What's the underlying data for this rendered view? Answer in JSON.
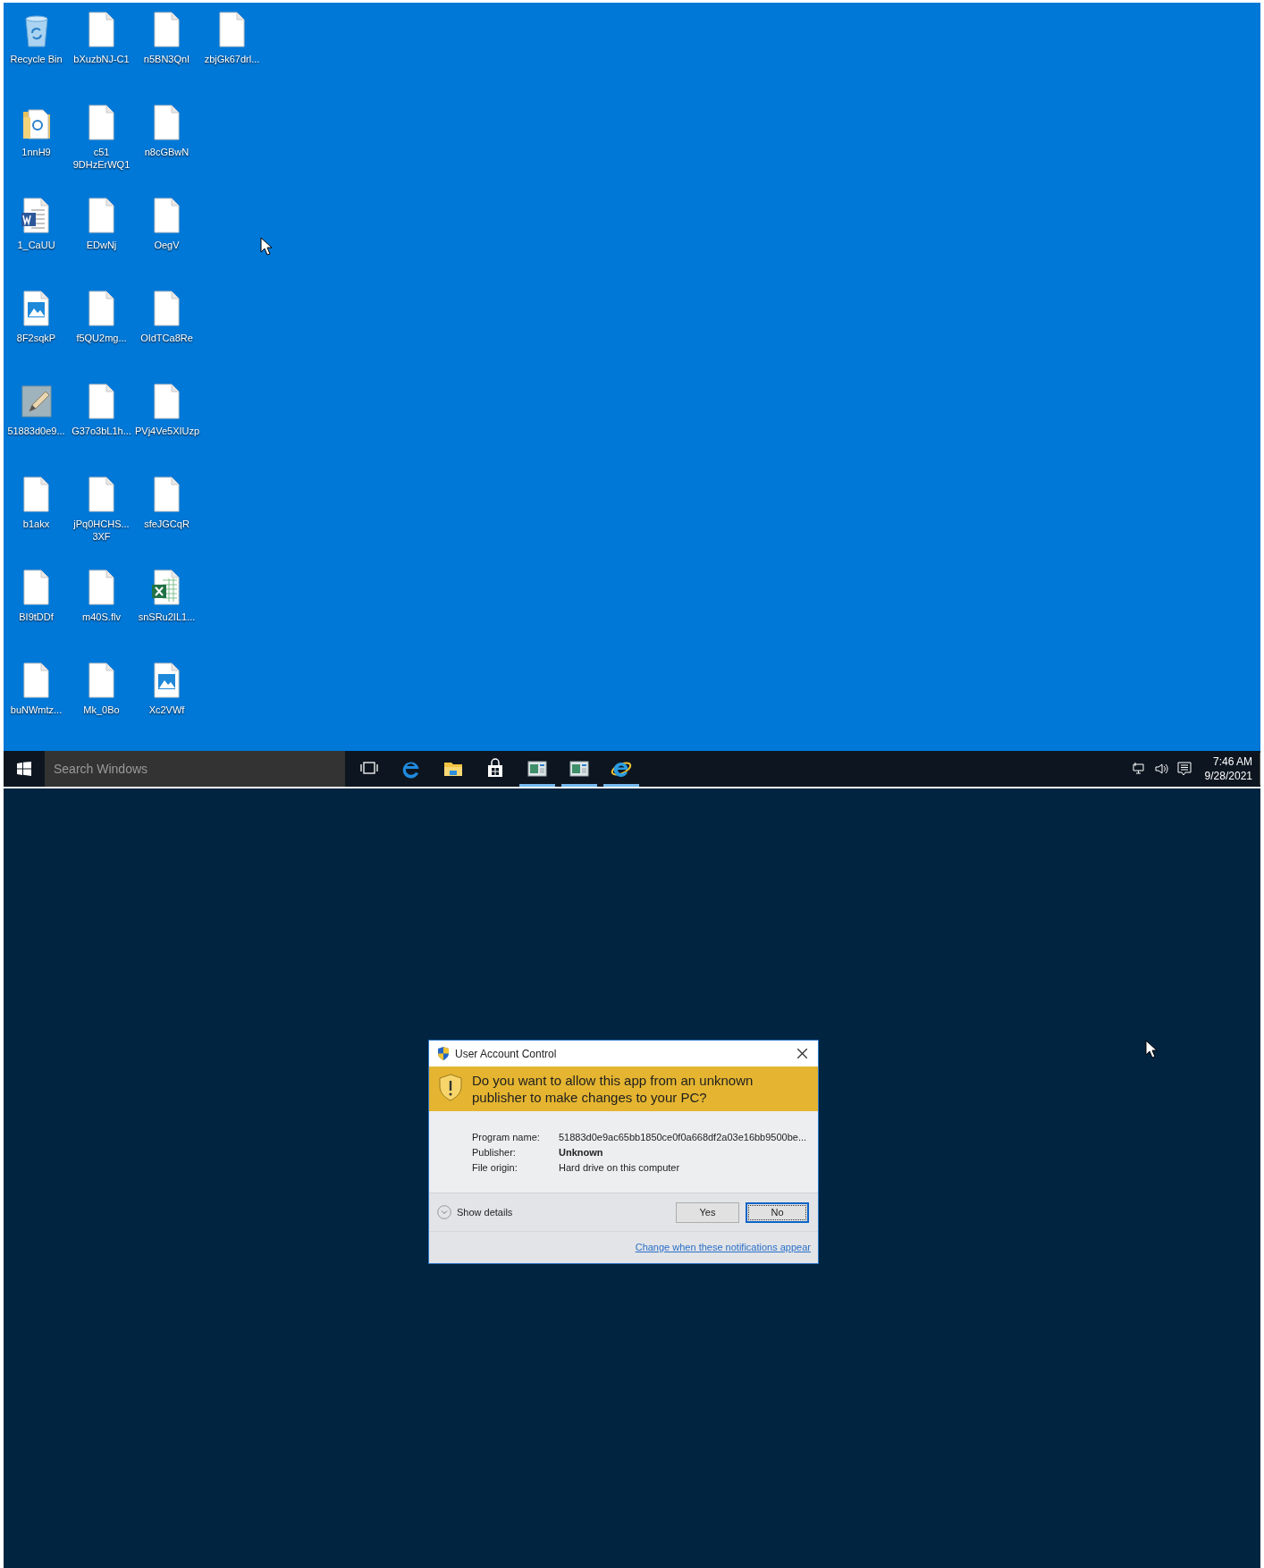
{
  "top_screen": {
    "desktop": {
      "icon_rows": [
        [
          {
            "label": "Recycle Bin",
            "kind": "recycle-bin"
          },
          {
            "label": "bXuzbNJ-C1",
            "kind": "file"
          },
          {
            "label": "n5BN3QnI",
            "kind": "file"
          },
          {
            "label": "zbjGk67drl...",
            "kind": "file"
          }
        ],
        [
          {
            "label": "1nnH9",
            "kind": "folder"
          },
          {
            "label": "c51 9DHzErWQ1",
            "kind": "file"
          },
          {
            "label": "n8cGBwN",
            "kind": "file"
          }
        ],
        [
          {
            "label": "1_CaUU",
            "kind": "word"
          },
          {
            "label": "EDwNj",
            "kind": "file"
          },
          {
            "label": "OegV",
            "kind": "file"
          }
        ],
        [
          {
            "label": "8F2sqkP",
            "kind": "image"
          },
          {
            "label": "f5QU2mg...",
            "kind": "file"
          },
          {
            "label": "OIdTCa8Re",
            "kind": "file"
          }
        ],
        [
          {
            "label": "51883d0e9...",
            "kind": "edit"
          },
          {
            "label": "G37o3bL1h...",
            "kind": "file"
          },
          {
            "label": "PVj4Ve5XIUzp",
            "kind": "file"
          }
        ],
        [
          {
            "label": "b1akx",
            "kind": "file"
          },
          {
            "label": "jPq0HCHS... 3XF",
            "kind": "file"
          },
          {
            "label": "sfeJGCqR",
            "kind": "file"
          }
        ],
        [
          {
            "label": "BI9tDDf",
            "kind": "file"
          },
          {
            "label": "m40S.flv",
            "kind": "file"
          },
          {
            "label": "snSRu2IL1...",
            "kind": "excel"
          }
        ],
        [
          {
            "label": "buNWmtz...",
            "kind": "file"
          },
          {
            "label": "Mk_0Bo",
            "kind": "file"
          },
          {
            "label": "Xc2VWf",
            "kind": "image"
          }
        ]
      ]
    },
    "taskbar": {
      "search": {
        "placeholder": "Search Windows"
      },
      "apps": [
        {
          "kind": "task-view",
          "running": false
        },
        {
          "kind": "edge",
          "running": false
        },
        {
          "kind": "explorer",
          "running": false
        },
        {
          "kind": "store",
          "running": false
        },
        {
          "kind": "window",
          "running": true
        },
        {
          "kind": "window",
          "running": true
        },
        {
          "kind": "ie",
          "running": true
        }
      ],
      "clock": {
        "time": "7:46 AM",
        "date": "9/28/2021"
      }
    }
  },
  "bottom_screen": {
    "dialog": {
      "title": "User Account Control",
      "question": "Do you want to allow this app from an unknown publisher to make changes to your PC?",
      "details": [
        {
          "label": "Program name:",
          "value": "51883d0e9ac65bb1850ce0f0a668df2a03e16bb9500be...",
          "emphasis": false
        },
        {
          "label": "Publisher:",
          "value": "Unknown",
          "emphasis": true
        },
        {
          "label": "File origin:",
          "value": "Hard drive on this computer",
          "emphasis": false
        }
      ],
      "show_details": "Show details",
      "buttons": [
        {
          "label": "Yes",
          "focused": false
        },
        {
          "label": "No",
          "focused": true
        }
      ],
      "link": "Change when these notifications appear"
    }
  }
}
